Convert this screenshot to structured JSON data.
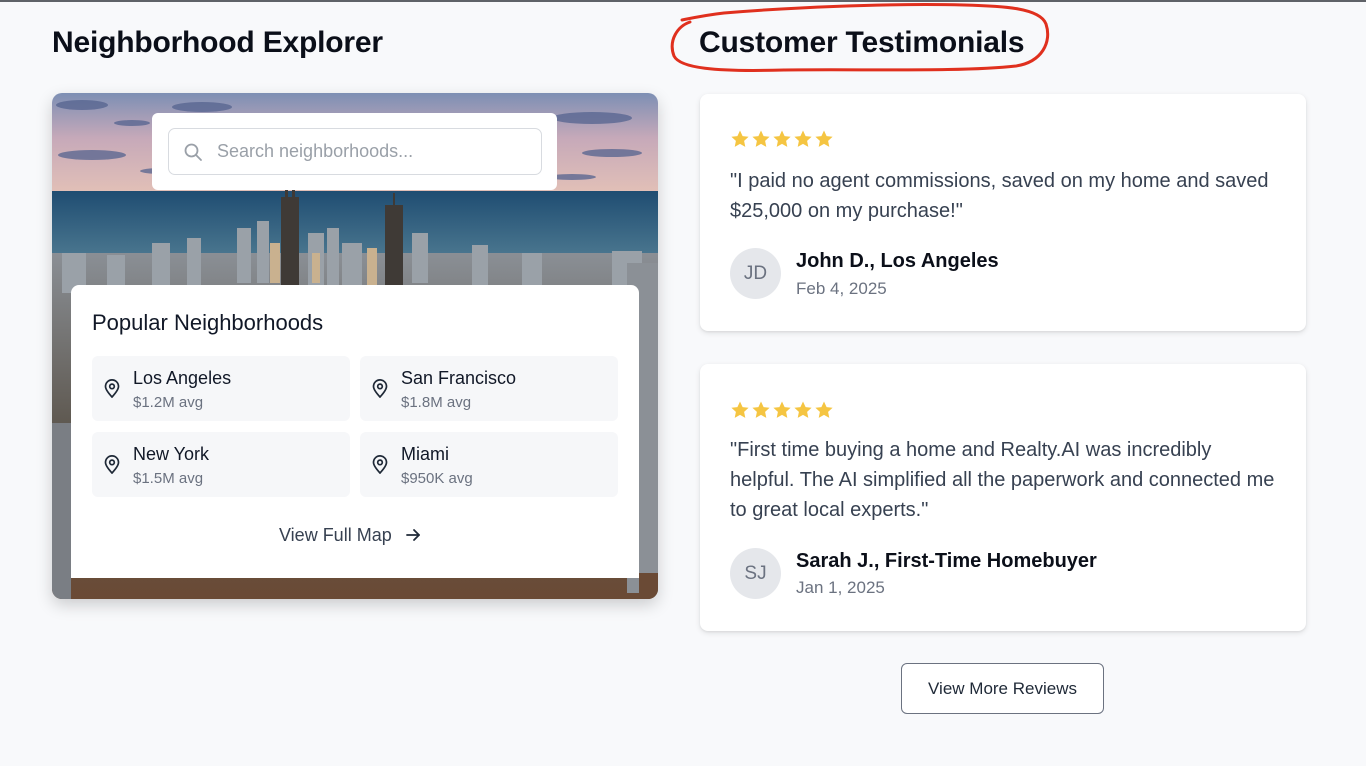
{
  "explorer": {
    "title": "Neighborhood Explorer",
    "search": {
      "placeholder": "Search neighborhoods...",
      "value": "",
      "icon": "search-icon"
    },
    "popular": {
      "title": "Popular Neighborhoods",
      "items": [
        {
          "name": "Los Angeles",
          "price": "$1.2M avg",
          "icon": "map-pin-icon"
        },
        {
          "name": "San Francisco",
          "price": "$1.8M avg",
          "icon": "map-pin-icon"
        },
        {
          "name": "New York",
          "price": "$1.5M avg",
          "icon": "map-pin-icon"
        },
        {
          "name": "Miami",
          "price": "$950K avg",
          "icon": "map-pin-icon"
        }
      ],
      "view_map_label": "View Full Map",
      "view_map_icon": "arrow-right-icon"
    }
  },
  "testimonials": {
    "title": "Customer Testimonials",
    "reviews": [
      {
        "rating": 5,
        "quote": "\"I paid no agent commissions, saved on my home and saved $25,000 on my purchase!\"",
        "initials": "JD",
        "author": "John D., Los Angeles",
        "date": "Feb 4, 2025"
      },
      {
        "rating": 5,
        "quote": "\"First time buying a home and Realty.AI was incredibly helpful. The AI simplified all the paperwork and connected me to great local experts.\"",
        "initials": "SJ",
        "author": "Sarah J., First-Time Homebuyer",
        "date": "Jan 1, 2025"
      }
    ],
    "more_label": "View More Reviews"
  },
  "colors": {
    "star": "#f5c542",
    "annotation": "#e0301e",
    "page_background": "#f8f9fb"
  }
}
